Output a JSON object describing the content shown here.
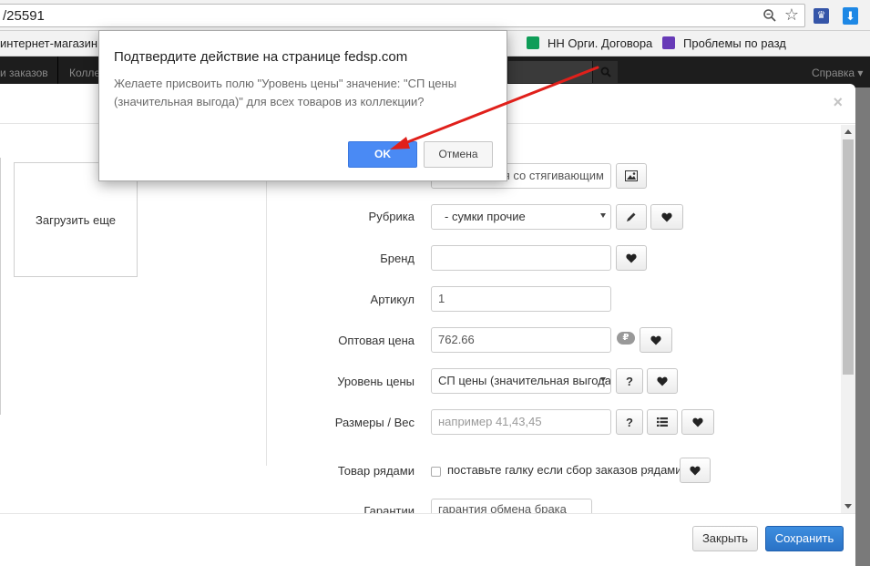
{
  "browser": {
    "url": "/25591",
    "bookmarks": [
      {
        "label": "интернет-магазин",
        "icon": "folder-icon"
      },
      {
        "label": "НН Орги. Договора",
        "icon": "google-sheets-icon",
        "color": "#0f9d58"
      },
      {
        "label": "Проблемы по разд",
        "icon": "google-forms-icon",
        "color": "#673ab7"
      }
    ]
  },
  "site_nav": {
    "items": [
      "и заказов",
      "Колле"
    ],
    "help": "Справка"
  },
  "modal": {
    "load_more": "Загрузить еще",
    "form": {
      "name_value": "ая со стягивающим",
      "rubric_label": "Рубрика",
      "rubric_value": "-  сумки прочие",
      "brand_label": "Бренд",
      "brand_value": "",
      "article_label": "Артикул",
      "article_value": "1",
      "wholesale_label": "Оптовая цена",
      "wholesale_value": "762.66",
      "ruble_badge": "₽",
      "price_level_label": "Уровень цены",
      "price_level_value": "СП цены (значительная выгода)",
      "sizes_label": "Размеры / Вес",
      "sizes_placeholder": "например 41,43,45",
      "rows_label": "Товар рядами",
      "rows_checkbox_text": "поставьте галку если сбор заказов рядами",
      "guarantee_label": "Гарантии",
      "guarantee_value": "гарантия обмена брака",
      "help_btn": "?"
    },
    "footer": {
      "close": "Закрыть",
      "save": "Сохранить"
    }
  },
  "confirm_dialog": {
    "title": "Подтвердите действие на странице fedsp.com",
    "message": "Желаете присвоить полю \"Уровень цены\" значение: \"СП цены (значительная выгода)\" для всех товаров из коллекции?",
    "ok": "OK",
    "cancel": "Отмена"
  },
  "colors": {
    "primary": "#2a72c6",
    "ok_button": "#4a8af4",
    "annotation_arrow": "#e0201b"
  }
}
